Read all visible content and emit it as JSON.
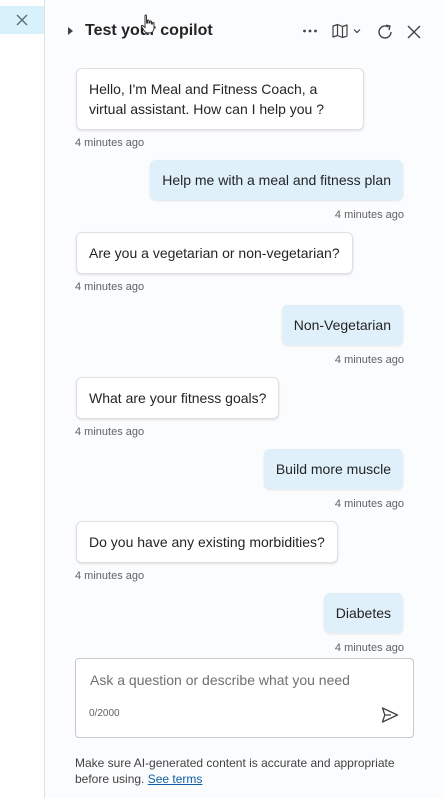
{
  "panel": {
    "title": "Test your copilot"
  },
  "icons": {
    "close_tab": "close-icon",
    "expand": "caret-right-icon",
    "more": "more-options-icon",
    "map": "map-icon",
    "dropdown": "chevron-down-icon",
    "refresh": "refresh-icon",
    "close": "close-icon",
    "send": "send-icon"
  },
  "conversation": [
    {
      "role": "bot",
      "text": "Hello, I'm Meal and Fitness Coach, a virtual assistant. How can I help you ?",
      "time": "4 minutes ago"
    },
    {
      "role": "user",
      "text": "Help me with a meal and fitness plan",
      "time": "4 minutes ago"
    },
    {
      "role": "bot",
      "text": "Are you a vegetarian or non-vegetarian?",
      "time": "4 minutes ago"
    },
    {
      "role": "user",
      "text": "Non-Vegetarian",
      "time": "4 minutes ago"
    },
    {
      "role": "bot",
      "text": "What are your fitness goals?",
      "time": "4 minutes ago"
    },
    {
      "role": "user",
      "text": "Build more muscle",
      "time": "4 minutes ago"
    },
    {
      "role": "bot",
      "text": "Do you have any existing morbidities?",
      "time": "4 minutes ago"
    },
    {
      "role": "user",
      "text": "Diabetes",
      "time": "4 minutes ago"
    }
  ],
  "input": {
    "placeholder": "Ask a question or describe what you need",
    "value": "",
    "counter": "0/2000"
  },
  "disclaimer": {
    "text": "Make sure AI-generated content is accurate and appropriate before using.",
    "link": "See terms"
  },
  "colors": {
    "user_bubble": "#dff0fa",
    "bot_bubble": "#ffffff",
    "accent": "#115ea3",
    "close_tab_bg": "#d7f2fb"
  }
}
